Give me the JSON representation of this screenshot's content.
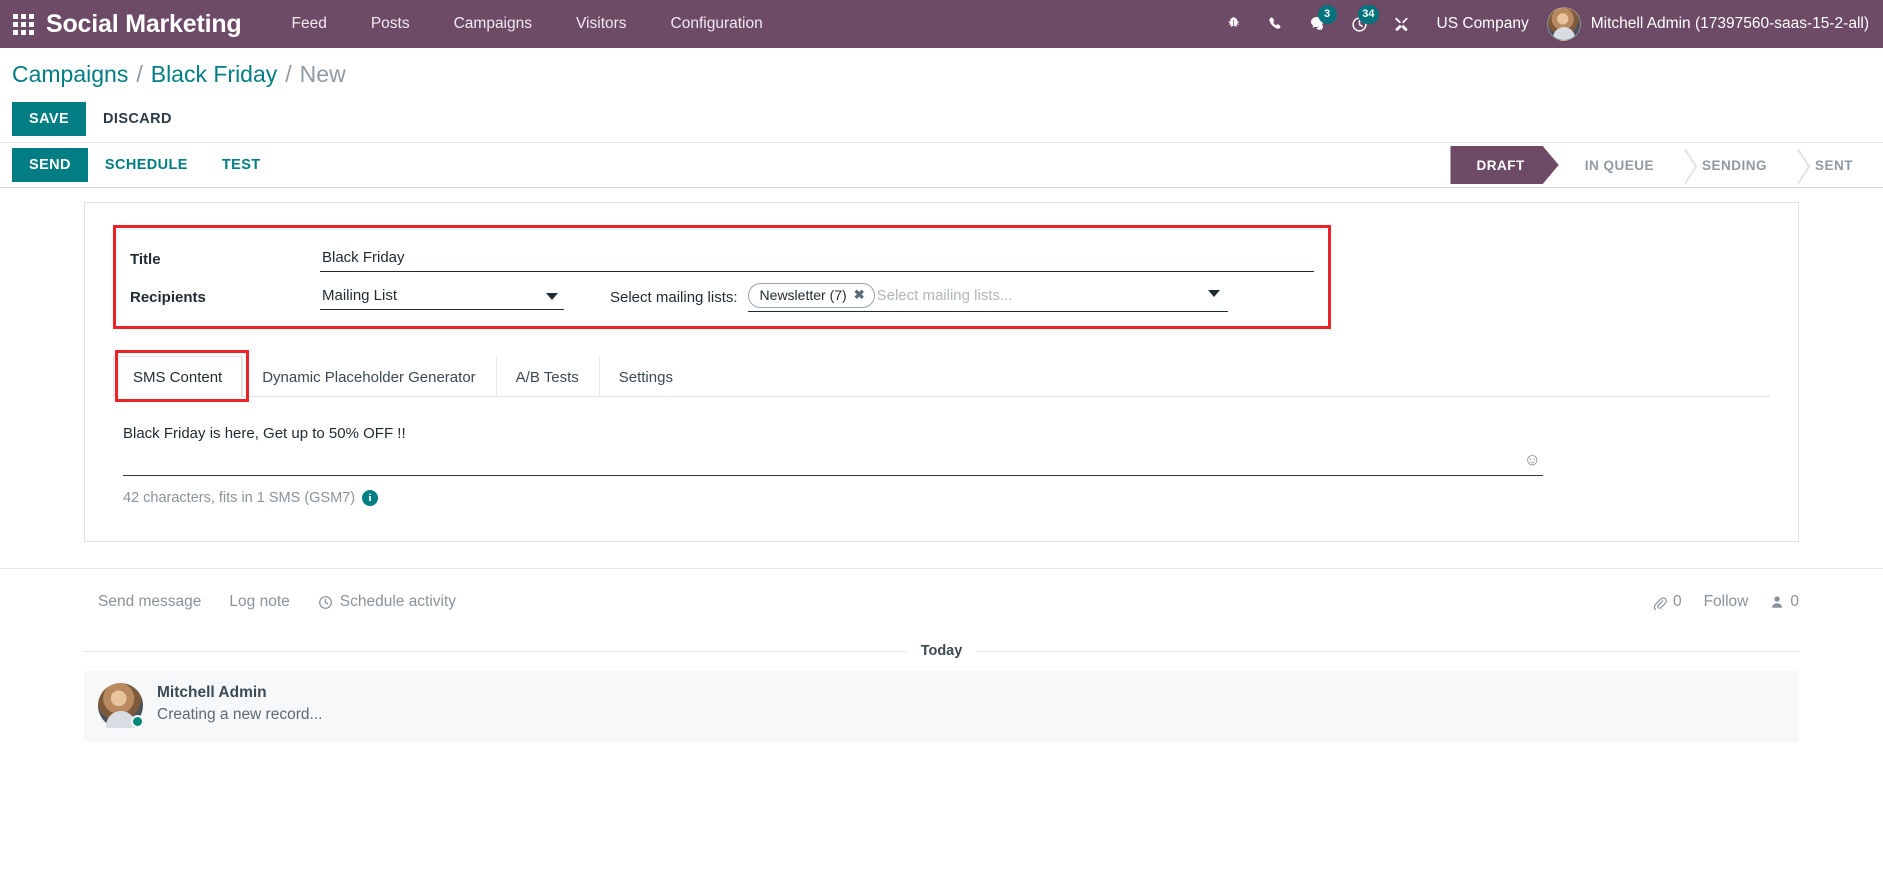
{
  "navbar": {
    "apps_icon": "apps-grid-icon",
    "brand": "Social Marketing",
    "menu": [
      {
        "label": "Feed"
      },
      {
        "label": "Posts"
      },
      {
        "label": "Campaigns"
      },
      {
        "label": "Visitors"
      },
      {
        "label": "Configuration"
      }
    ],
    "icons": [
      {
        "name": "bug-icon",
        "badge": null
      },
      {
        "name": "phone-icon",
        "badge": null
      },
      {
        "name": "messages-icon",
        "badge": "3"
      },
      {
        "name": "activity-clock-icon",
        "badge": "34"
      },
      {
        "name": "tools-icon",
        "badge": null
      }
    ],
    "company": "US Company",
    "user": "Mitchell Admin (17397560-saas-15-2-all)"
  },
  "breadcrumb": {
    "root": "Campaigns",
    "sep": "/",
    "parent": "Black Friday",
    "current": "New"
  },
  "actions": {
    "save": "SAVE",
    "discard": "DISCARD"
  },
  "mailing_actions": {
    "send": "SEND",
    "schedule": "SCHEDULE",
    "test": "TEST"
  },
  "statusbar": {
    "stages": [
      {
        "label": "DRAFT",
        "active": true
      },
      {
        "label": "IN QUEUE",
        "active": false
      },
      {
        "label": "SENDING",
        "active": false
      },
      {
        "label": "SENT",
        "active": false
      }
    ]
  },
  "form": {
    "title_label": "Title",
    "title_value": "Black Friday",
    "recipients_label": "Recipients",
    "recipients_value": "Mailing List",
    "recipients_options": [
      "Mailing List"
    ],
    "mailing_lists_label": "Select mailing lists:",
    "mailing_list_tag": "Newsletter (7)",
    "mailing_list_tag_remove": "✖",
    "mailing_lists_placeholder": "Select mailing lists..."
  },
  "tabs": [
    {
      "label": "SMS Content",
      "active": true
    },
    {
      "label": "Dynamic Placeholder Generator",
      "active": false
    },
    {
      "label": "A/B Tests",
      "active": false
    },
    {
      "label": "Settings",
      "active": false
    }
  ],
  "sms": {
    "body": "Black Friday is here, Get up to 50% OFF !!",
    "emoji_icon": "☺",
    "char_count": "42 characters, fits in 1 SMS (GSM7)",
    "info_icon": "i"
  },
  "chatter": {
    "send_message": "Send message",
    "log_note": "Log note",
    "schedule_activity": "Schedule activity",
    "attachments_count": "0",
    "follow": "Follow",
    "followers_count": "0",
    "today": "Today",
    "message": {
      "author": "Mitchell Admin",
      "text": "Creating a new record..."
    }
  },
  "colors": {
    "brand_purple": "#6d4a66",
    "accent_teal": "#017e84",
    "annotation_red": "#ec2227",
    "badge_teal": "#00737d"
  }
}
